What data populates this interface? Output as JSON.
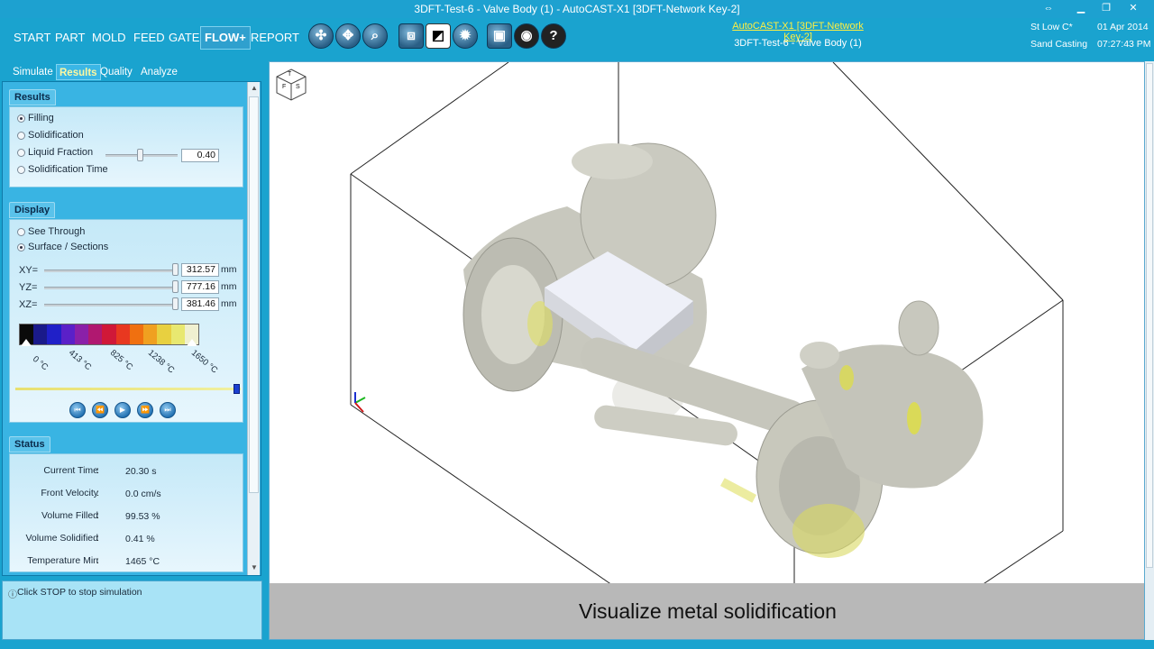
{
  "window": {
    "title": "3DFT-Test-6 - Valve Body (1) - AutoCAST-X1 [3DFT-Network Key-2]",
    "controls": [
      "⇔",
      "▁",
      "❐",
      "✕"
    ]
  },
  "menu": {
    "items": [
      "START",
      "PART",
      "MOLD",
      "FEED",
      "GATE",
      "FLOW+",
      "REPORT"
    ],
    "active": "FLOW+"
  },
  "toolbar": {
    "icons": [
      "rotate-icon",
      "pan-icon",
      "zoom-icon",
      "fit-icon",
      "section-icon",
      "settings-icon",
      "camera-icon",
      "video-icon",
      "help-icon"
    ]
  },
  "network": {
    "link": "AutoCAST-X1 [3DFT-Network Key-2]",
    "sub": "3DFT-Test-6 - Valve Body (1)"
  },
  "header_info": {
    "material": "St Low C*",
    "process": "Sand Casting",
    "date": "01 Apr 2014",
    "time": "07:27:43 PM"
  },
  "subtabs": [
    "Simulate",
    "Results",
    "Quality",
    "Analyze"
  ],
  "results": {
    "heading": "Results",
    "options": [
      "Filling",
      "Solidification",
      "Liquid Fraction",
      "Solidification Time"
    ],
    "liquid_fraction_value": "0.40"
  },
  "display": {
    "heading": "Display",
    "options": [
      "See Through",
      "Surface / Sections"
    ],
    "planes": [
      {
        "label": "XY=",
        "value": "312.57",
        "unit": "mm"
      },
      {
        "label": "YZ=",
        "value": "777.16",
        "unit": "mm"
      },
      {
        "label": "XZ=",
        "value": "381.46",
        "unit": "mm"
      }
    ],
    "scale_ticks": [
      "0 °C",
      "413 °C",
      "825 °C",
      "1238 °C",
      "1650 °C"
    ],
    "scale_colors": [
      "#0a0a0a",
      "#1a1a8a",
      "#2020c8",
      "#5a20c8",
      "#8a20a8",
      "#b01870",
      "#d01838",
      "#e83820",
      "#f07010",
      "#f0a020",
      "#e8d040",
      "#e8e870",
      "#f0f0d0"
    ]
  },
  "status": {
    "heading": "Status",
    "rows": [
      {
        "label": "Current Time",
        "value": "20.30 s"
      },
      {
        "label": "Front Velocity",
        "value": "0.0 cm/s"
      },
      {
        "label": "Volume Filled",
        "value": "99.53 %"
      },
      {
        "label": "Volume Solidified",
        "value": "0.41 %"
      },
      {
        "label": "Temperature Min",
        "value": "1465 °C"
      }
    ]
  },
  "hint": "Click STOP to stop simulation",
  "caption": "Visualize metal solidification",
  "view_cube_letters": [
    "T",
    "F",
    "S"
  ]
}
